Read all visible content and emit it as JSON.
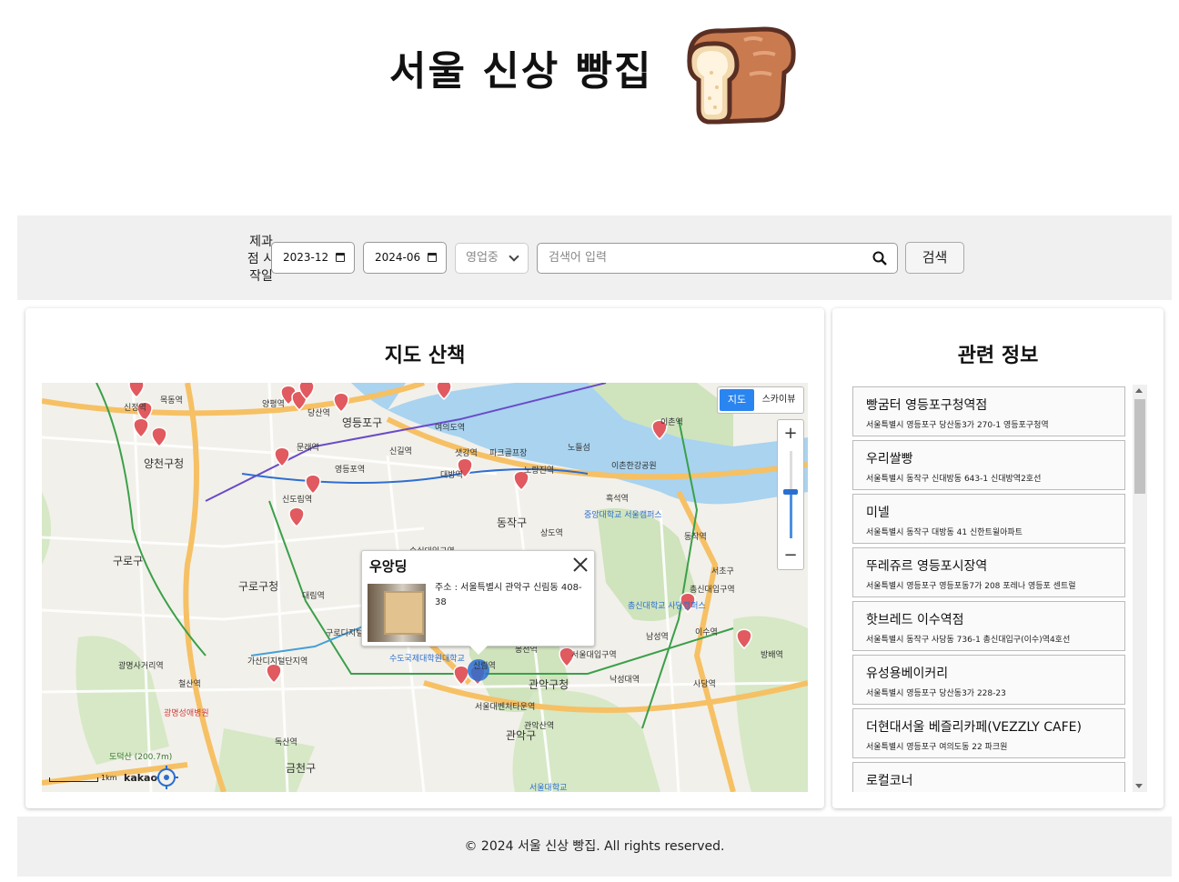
{
  "header": {
    "title": "서울 신상 빵집",
    "logo_icon": "bread-icon"
  },
  "search": {
    "label": "제과점 시작일",
    "start_date": "2023-12",
    "end_date": "2024-06",
    "status_select": "영업중",
    "placeholder": "검색어 입력",
    "button_label": "검색"
  },
  "map_section": {
    "title": "지도 산책",
    "map_type_active": "지도",
    "map_type_other": "스카이뷰",
    "zoom_in": "+",
    "zoom_out": "−",
    "scale_label": "1km",
    "provider": "kakao",
    "info_window": {
      "title": "우앙딩",
      "address": "주소 : 서울특별시 관악구 신림동 408-38"
    },
    "map_labels": [
      {
        "text": "영등포구"
      },
      {
        "text": "여의도역"
      },
      {
        "text": "신길역"
      },
      {
        "text": "샛강역"
      },
      {
        "text": "양천구청"
      },
      {
        "text": "구로구청"
      },
      {
        "text": "관악구청"
      },
      {
        "text": "동작구"
      },
      {
        "text": "노량진역"
      },
      {
        "text": "대림역"
      },
      {
        "text": "구로디지털단지역"
      },
      {
        "text": "가산디지털단지역"
      },
      {
        "text": "신도림역"
      },
      {
        "text": "이촌역"
      },
      {
        "text": "동작역"
      },
      {
        "text": "이수역"
      },
      {
        "text": "사당역"
      },
      {
        "text": "서울대입구역"
      },
      {
        "text": "낙성대역"
      },
      {
        "text": "봉천역"
      },
      {
        "text": "신림역"
      },
      {
        "text": "서울대벤처타운역"
      },
      {
        "text": "관악산역"
      },
      {
        "text": "관악구"
      },
      {
        "text": "금천구"
      },
      {
        "text": "독산역"
      },
      {
        "text": "광명사거리역"
      },
      {
        "text": "철산역"
      },
      {
        "text": "구로구"
      },
      {
        "text": "신정역"
      },
      {
        "text": "목동역"
      },
      {
        "text": "양평역"
      },
      {
        "text": "당산역"
      },
      {
        "text": "문래역"
      },
      {
        "text": "영등포역"
      },
      {
        "text": "대방역"
      },
      {
        "text": "흑석역"
      },
      {
        "text": "상도역"
      },
      {
        "text": "숭실대입구역"
      },
      {
        "text": "남성역"
      },
      {
        "text": "방배역"
      },
      {
        "text": "서초구"
      },
      {
        "text": "총신대입구역"
      },
      {
        "text": "중앙대학교 서울캠퍼스"
      },
      {
        "text": "총신대학교 사당캠퍼스"
      },
      {
        "text": "수도국제대학원대학교"
      },
      {
        "text": "광명성애병원"
      },
      {
        "text": "도덕산 (200.7m)"
      },
      {
        "text": "노들섬"
      },
      {
        "text": "이촌한강공원"
      },
      {
        "text": "파크골프장"
      },
      {
        "text": "서울대학교"
      }
    ]
  },
  "related_section": {
    "title": "관련 정보",
    "items": [
      {
        "name": "빵굼터 영등포구청역점",
        "address": "서울특별시 영등포구 당산동3가 270-1 영등포구청역"
      },
      {
        "name": "우리쌀빵",
        "address": "서울특별시 동작구 신대방동 643-1 신대방역2호선"
      },
      {
        "name": "미넬",
        "address": "서울특별시 동작구 대방동 41 신한트윌아파트"
      },
      {
        "name": "뚜레쥬르 영등포시장역",
        "address": "서울특별시 영등포구 영등포동7가 208 포레나 영등포 센트럴"
      },
      {
        "name": "핫브레드 이수역점",
        "address": "서울특별시 동작구 사당동 736-1 총신대입구(이수)역4호선"
      },
      {
        "name": "유성용베이커리",
        "address": "서울특별시 영등포구 당산동3가 228-23"
      },
      {
        "name": "더현대서울 베즐리카페(VEZZLY CAFE)",
        "address": "서울특별시 영등포구 여의도동 22 파크원"
      },
      {
        "name": "로컬코너",
        "address": ""
      }
    ]
  },
  "footer": {
    "text": "© 2024 서울 신상 빵집. All rights reserved."
  },
  "colors": {
    "marker": "#e05a5f",
    "accent": "#2a85f0",
    "river": "#a9d3ef",
    "road_major": "#f6c064"
  }
}
